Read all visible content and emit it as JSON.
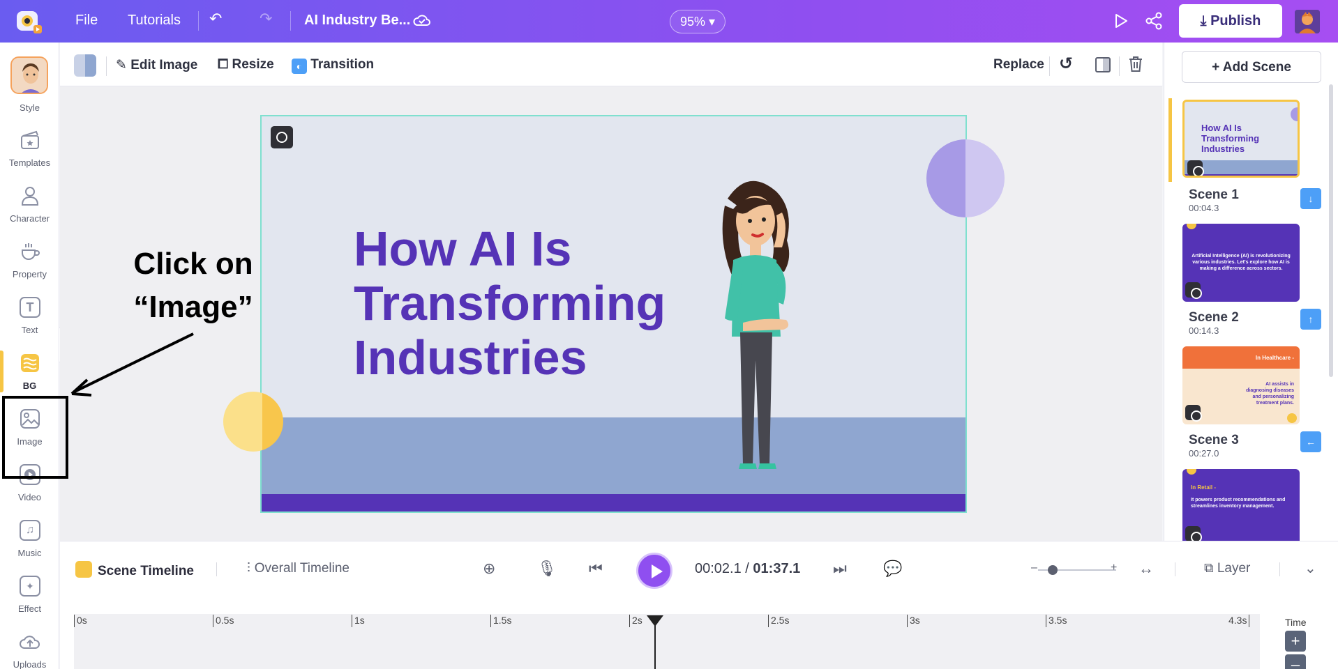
{
  "topbar": {
    "file": "File",
    "tutorials": "Tutorials",
    "project_title": "AI Industry Be...",
    "zoom": "95%",
    "publish": "Publish",
    "undo_icon": "undo-icon",
    "redo_icon": "redo-icon"
  },
  "sidebar": {
    "items": [
      {
        "label": "Style"
      },
      {
        "label": "Templates"
      },
      {
        "label": "Character"
      },
      {
        "label": "Property"
      },
      {
        "label": "Text"
      },
      {
        "label": "BG"
      },
      {
        "label": "Image"
      },
      {
        "label": "Video"
      },
      {
        "label": "Music"
      },
      {
        "label": "Effect"
      },
      {
        "label": "Uploads"
      }
    ]
  },
  "toolbar": {
    "edit_image": "Edit Image",
    "resize": "Resize",
    "transition": "Transition",
    "replace": "Replace"
  },
  "canvas": {
    "headline_lines": [
      "How AI Is",
      "Transforming",
      "Industries"
    ]
  },
  "annotation": {
    "line1": "Click on",
    "line2": "“Image”"
  },
  "scenes": {
    "add_label": "+ Add Scene",
    "list": [
      {
        "name": "Scene 1",
        "time": "00:04.3",
        "thumb_text": "How AI Is Transforming Industries"
      },
      {
        "name": "Scene 2",
        "time": "00:14.3",
        "thumb_text": "Artificial Intelligence (AI) is revolutionizing various industries. Let's explore how AI is making a difference across sectors."
      },
      {
        "name": "Scene 3",
        "time": "00:27.0",
        "thumb_title": "In Healthcare -",
        "thumb_text": "AI assists in diagnosing diseases and personalizing treatment plans."
      },
      {
        "thumb_title": "In Retail -",
        "thumb_text": "It powers product recommendations and streamlines inventory management."
      }
    ]
  },
  "timeline": {
    "scene_tab": "Scene Timeline",
    "overall_tab": "Overall Timeline",
    "current": "00:02.1",
    "separator": "/",
    "total": "01:37.1",
    "layer": "Layer",
    "time_label": "Time",
    "ticks": [
      "0s",
      "0.5s",
      "1s",
      "1.5s",
      "2s",
      "2.5s",
      "3s",
      "3.5s",
      "4.3s"
    ]
  },
  "colors": {
    "topbar_start": "#6a5cf0",
    "topbar_end": "#a64ef2",
    "headline": "#5533b6",
    "accent_yellow": "#f6c544",
    "scene_btn": "#4d9ff7"
  }
}
